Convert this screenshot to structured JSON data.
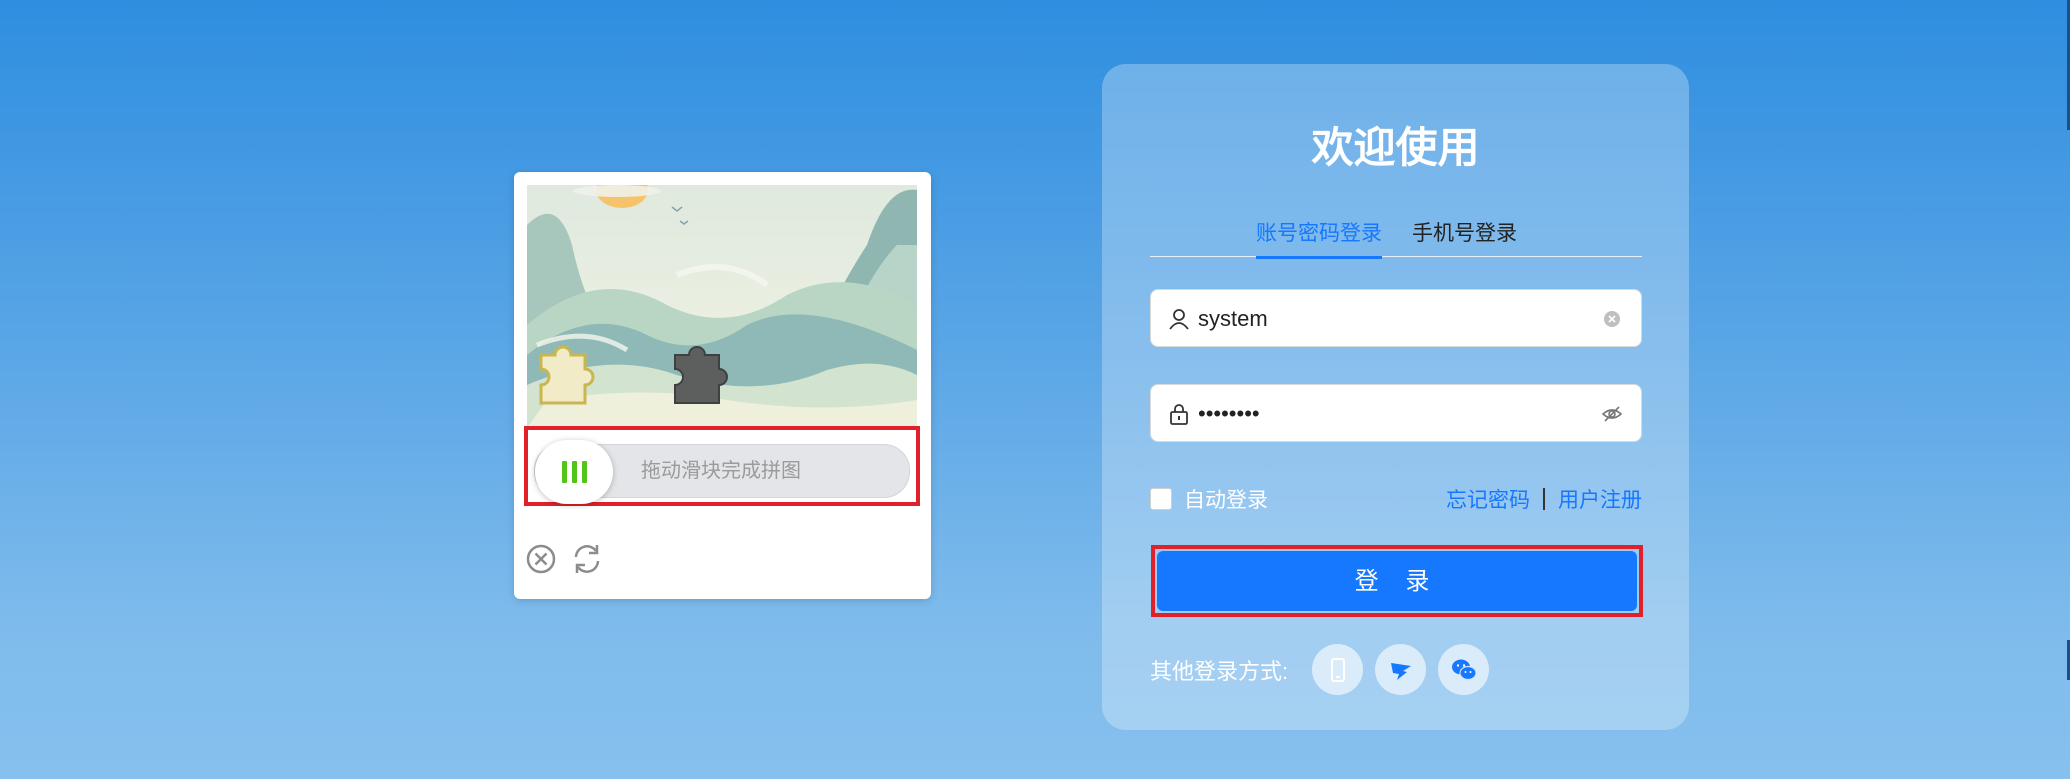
{
  "colors": {
    "accent": "#1677ff",
    "highlight_box": "#e0202a",
    "slider_knob_bars": "#52c41a"
  },
  "captcha": {
    "slider_hint": "拖动滑块完成拼图",
    "icons": [
      "close-circle-icon",
      "refresh-icon"
    ]
  },
  "login": {
    "title": "欢迎使用",
    "tabs": [
      {
        "label": "账号密码登录",
        "active": true
      },
      {
        "label": "手机号登录",
        "active": false
      }
    ],
    "username": {
      "value": "system",
      "icon": "user-icon",
      "suffix_icon": "clear-icon"
    },
    "password": {
      "masked_value": "••••••••",
      "icon": "lock-icon",
      "suffix_icon": "eye-hidden-icon"
    },
    "remember_label": "自动登录",
    "forgot_label": "忘记密码",
    "register_label": "用户注册",
    "submit_label": "登 录",
    "other_label": "其他登录方式:",
    "other_methods": [
      "mobile-icon",
      "dingtalk-icon",
      "wechat-icon"
    ]
  }
}
